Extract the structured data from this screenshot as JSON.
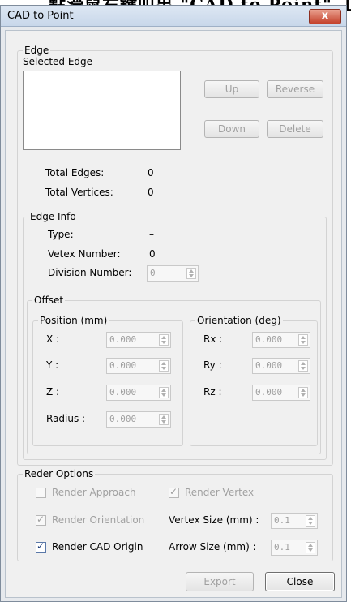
{
  "background_text": "點滑鼠右鍵叫出 \"CAD to Point\" 工具",
  "window": {
    "title": "CAD to Point",
    "close_glyph": "x"
  },
  "edge": {
    "legend": "Edge",
    "selected_edge_label": "Selected Edge",
    "buttons": {
      "up": "Up",
      "reverse": "Reverse",
      "down": "Down",
      "delete": "Delete"
    },
    "total_edges_label": "Total Edges:",
    "total_edges_value": "0",
    "total_vertices_label": "Total Vertices:",
    "total_vertices_value": "0"
  },
  "edge_info": {
    "legend": "Edge Info",
    "type_label": "Type:",
    "type_value": "–",
    "vertex_number_label": "Vetex Number:",
    "vertex_number_value": "0",
    "division_number_label": "Division Number:",
    "division_number_value": "0"
  },
  "offset": {
    "legend": "Offset",
    "position": {
      "legend": "Position (mm)",
      "x_label": "X :",
      "x_value": "0.000",
      "y_label": "Y :",
      "y_value": "0.000",
      "z_label": "Z :",
      "z_value": "0.000",
      "radius_label": "Radius :",
      "radius_value": "0.000"
    },
    "orientation": {
      "legend": "Orientation (deg)",
      "rx_label": "Rx :",
      "rx_value": "0.000",
      "ry_label": "Ry :",
      "ry_value": "0.000",
      "rz_label": "Rz :",
      "rz_value": "0.000"
    }
  },
  "render_options": {
    "legend": "Reder Options",
    "render_approach": "Render Approach",
    "render_vertex": "Render Vertex",
    "render_orientation": "Render Orientation",
    "render_cad_origin": "Render CAD Origin",
    "vertex_size_label": "Vertex Size (mm) :",
    "vertex_size_value": "0.1",
    "arrow_size_label": "Arrow Size (mm) :",
    "arrow_size_value": "0.1"
  },
  "footer": {
    "export": "Export",
    "close": "Close"
  }
}
